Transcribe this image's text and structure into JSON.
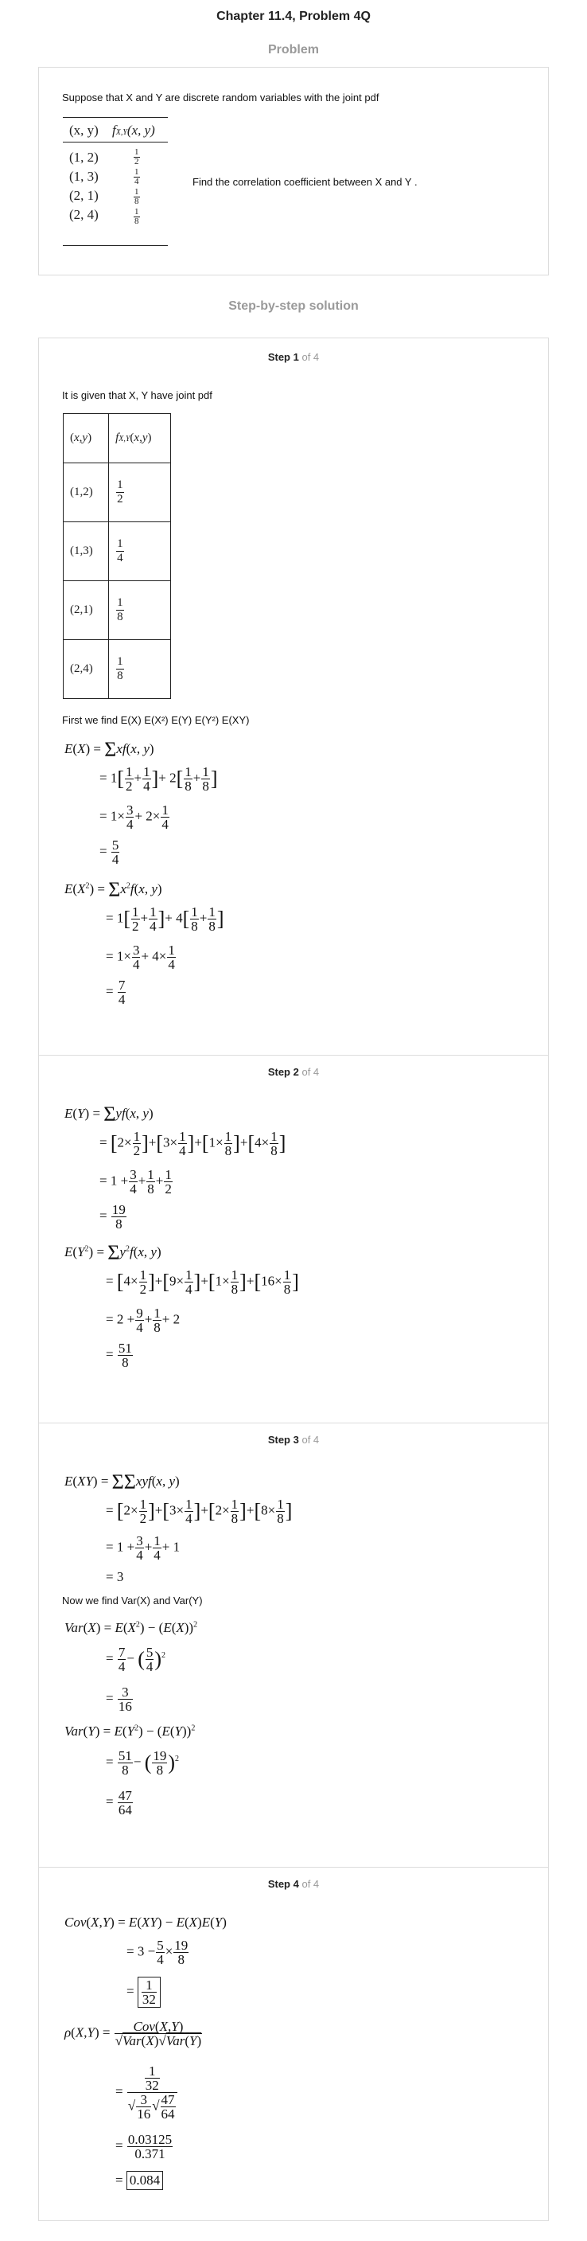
{
  "title": "Chapter 11.4, Problem 4Q",
  "problem_heading": "Problem",
  "problem": {
    "text": "Suppose that X and Y are discrete random variables with the joint pdf",
    "table_headers": [
      "(x, y)",
      "f_{X,Y}(x, y)"
    ],
    "rows": [
      [
        "(1, 2)",
        "1/2"
      ],
      [
        "(1, 3)",
        "1/4"
      ],
      [
        "(2, 1)",
        "1/8"
      ],
      [
        "(2, 4)",
        "1/8"
      ]
    ],
    "question": "Find the correlation coefficient between X and Y ."
  },
  "solution_heading": "Step-by-step solution",
  "steps": [
    {
      "label": "Step 1",
      "of": "of 4"
    },
    {
      "label": "Step 2",
      "of": "of 4"
    },
    {
      "label": "Step 3",
      "of": "of 4"
    },
    {
      "label": "Step 4",
      "of": "of 4"
    }
  ],
  "step1": {
    "given": "It is given that  X, Y have joint pdf",
    "first": "First we find  E(X)  E(X²)  E(Y)  E(Y²)  E(XY)"
  },
  "step3": {
    "now": "Now we find  Var(X) and  Var(Y)"
  },
  "final": {
    "cov": "1/32",
    "rho": "0.084"
  }
}
